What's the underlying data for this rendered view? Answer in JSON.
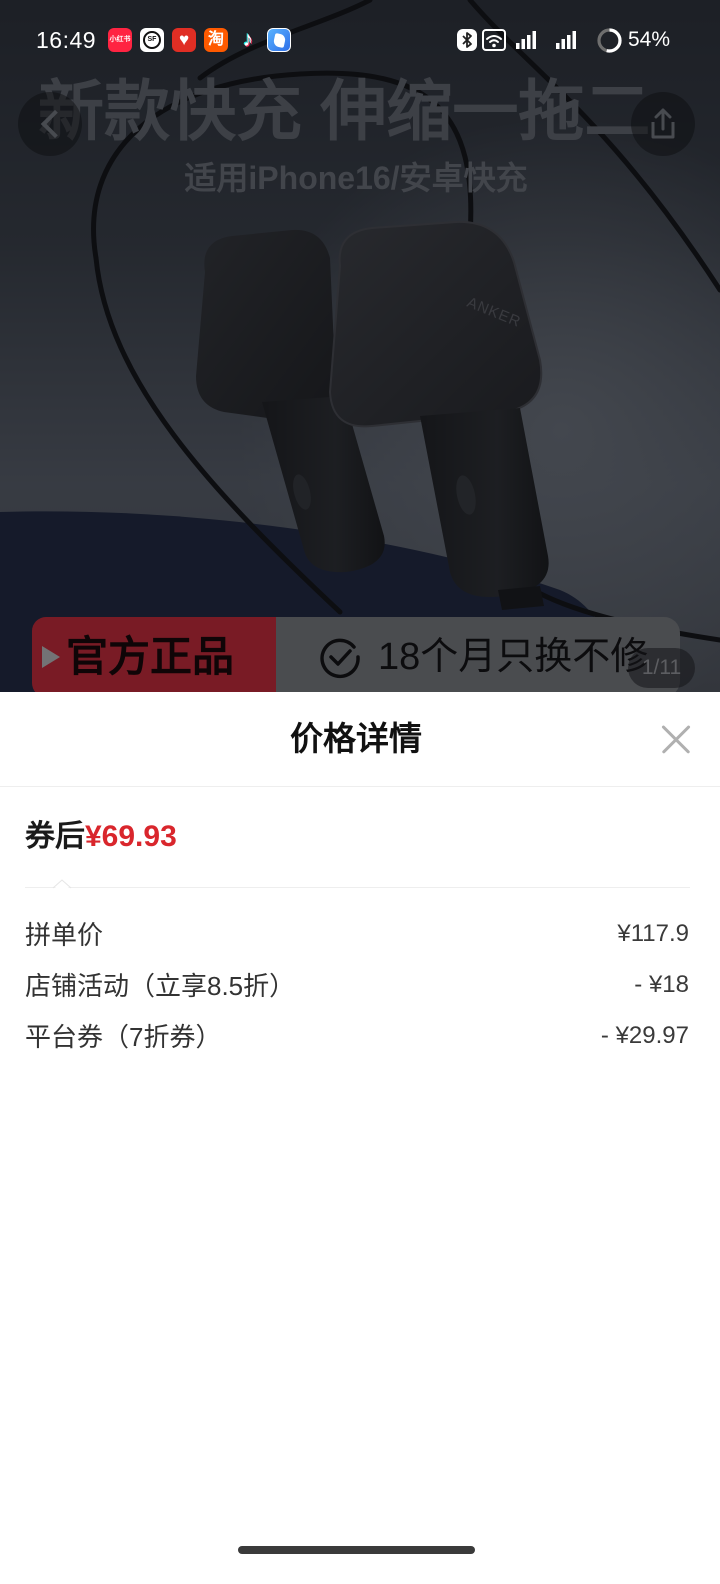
{
  "status_bar": {
    "time": "16:49",
    "battery_percent": "54%",
    "battery_level": 0.54,
    "app_icons": [
      {
        "icon": "xiaohongshu-icon",
        "text": "小红书",
        "color": "#ff2442"
      },
      {
        "icon": "sf-express-icon",
        "text": "SF",
        "color": "#ffffff"
      },
      {
        "icon": "pinduoduo-icon",
        "color": "#e02e24"
      },
      {
        "icon": "taobao-icon",
        "text": "淘",
        "color": "#ff5a00"
      },
      {
        "icon": "tiktok-icon",
        "color": "#111111"
      },
      {
        "icon": "blue-app-icon",
        "color": "#2f6fe8"
      }
    ],
    "system_icons": [
      "bluetooth-icon",
      "wifi-icon",
      "signal-icon",
      "signal-icon",
      "battery-ring-icon"
    ]
  },
  "product": {
    "headline": "新款快充 伸缩一拖二",
    "subheadline": "适用iPhone16/安卓快充",
    "brand_logo": "ANKER",
    "badge_official": "官方正品",
    "warranty": "18个月只换不修",
    "page_indicator": "1/11",
    "nav": {
      "back_icon": "back-chevron-icon",
      "share_icon": "share-icon"
    }
  },
  "price_sheet": {
    "title": "价格详情",
    "close_icon": "close-icon",
    "after_coupon_label": "券后",
    "after_coupon_price": "¥69.93",
    "rows": [
      {
        "label": "拼单价",
        "value": "¥117.9"
      },
      {
        "label": "店铺活动（立享8.5折）",
        "value": "- ¥18"
      },
      {
        "label": "平台券（7折券）",
        "value": "- ¥29.97"
      }
    ]
  },
  "colors": {
    "price_red": "#d9262c",
    "badge_red": "#f2374a",
    "text_primary": "#111111",
    "text_secondary": "#333333",
    "divider": "#eeeeee",
    "backdrop": "rgba(0,0,0,0.5)"
  }
}
